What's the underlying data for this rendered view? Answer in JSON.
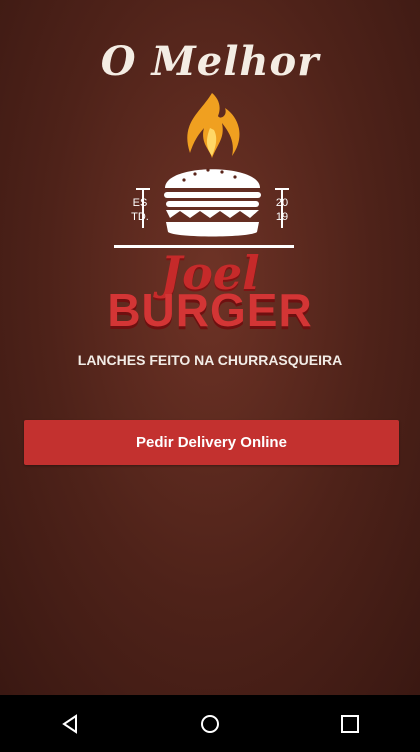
{
  "tagline": "O Melhor",
  "logo": {
    "est_left": "ES\nTD.",
    "est_right": "20\n19",
    "flame_color": "#f0a020",
    "burger_color": "#ffffff"
  },
  "brand": {
    "script_name": "Joel",
    "block_name": "BURGER",
    "color": "#d33535"
  },
  "subtitle": "LANCHES FEITO NA CHURRASQUEIRA",
  "cta": {
    "label": "Pedir Delivery Online",
    "color": "#c3312f"
  },
  "navbar": {
    "back_icon": "back-triangle-icon",
    "home_icon": "home-circle-icon",
    "recents_icon": "recents-square-icon"
  }
}
